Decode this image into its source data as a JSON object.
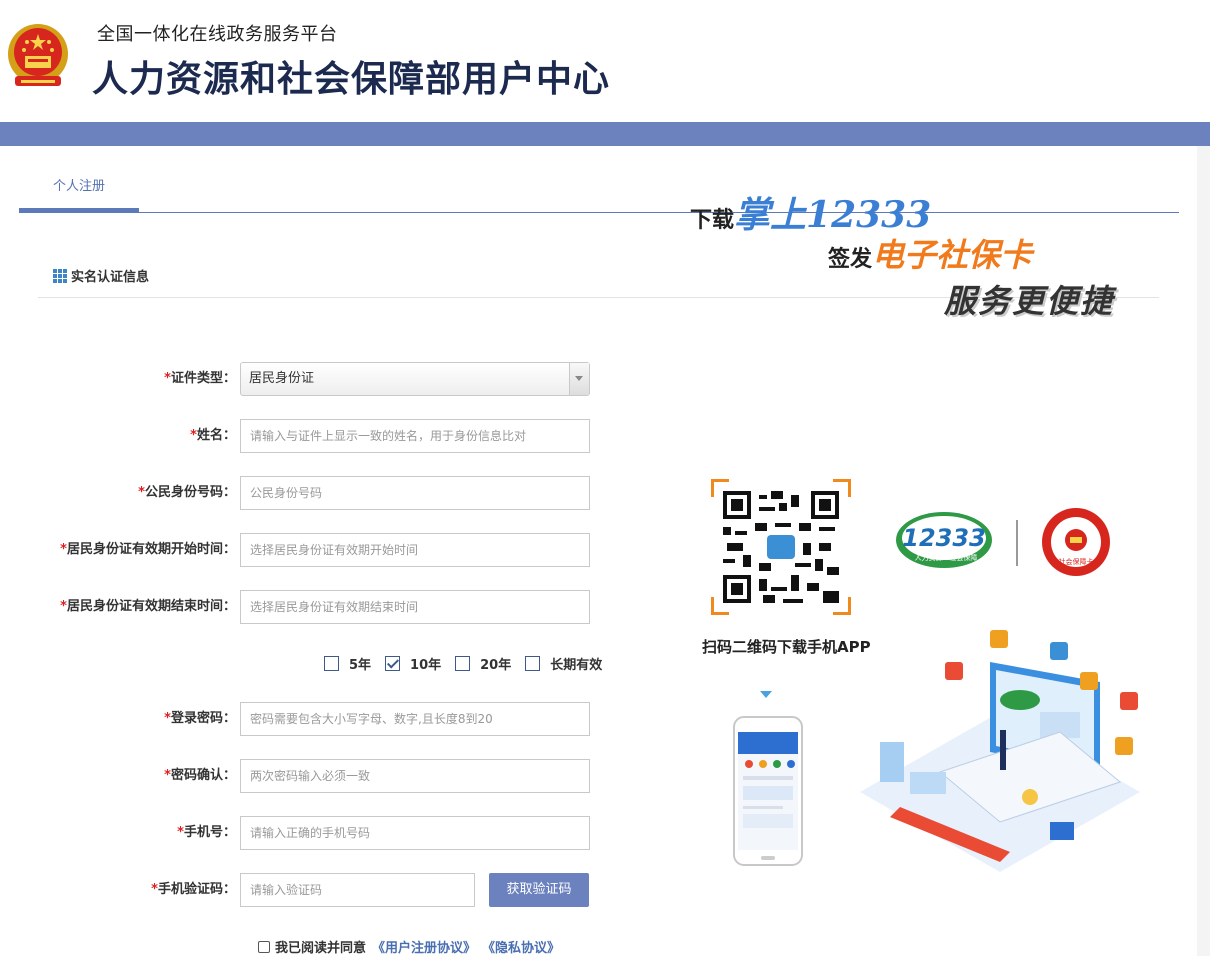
{
  "header": {
    "subtitle": "全国一体化在线政务服务平台",
    "title": "人力资源和社会保障部用户中心"
  },
  "tabs": [
    {
      "label": "个人注册",
      "active": true
    }
  ],
  "section": {
    "title": "实名认证信息"
  },
  "form": {
    "id_type": {
      "label": "证件类型",
      "value": "居民身份证"
    },
    "name": {
      "label": "姓名",
      "placeholder": "请输入与证件上显示一致的姓名，用于身份信息比对"
    },
    "id_number": {
      "label": "公民身份号码",
      "placeholder": "公民身份号码"
    },
    "valid_start": {
      "label": "居民身份证有效期开始时间",
      "placeholder": "选择居民身份证有效期开始时间"
    },
    "valid_end": {
      "label": "居民身份证有效期结束时间",
      "placeholder": "选择居民身份证有效期结束时间"
    },
    "validity_options": [
      {
        "label": "5年",
        "checked": false
      },
      {
        "label": "10年",
        "checked": true
      },
      {
        "label": "20年",
        "checked": false
      },
      {
        "label": "长期有效",
        "checked": false
      }
    ],
    "password": {
      "label": "登录密码",
      "placeholder": "密码需要包含大小写字母、数字,且长度8到20"
    },
    "password_confirm": {
      "label": "密码确认",
      "placeholder": "两次密码输入必须一致"
    },
    "phone": {
      "label": "手机号",
      "placeholder": "请输入正确的手机号码"
    },
    "sms_code": {
      "label": "手机验证码",
      "placeholder": "请输入验证码",
      "button": "获取验证码"
    },
    "label_suffix": "：",
    "required_mark": "*"
  },
  "agreement": {
    "text": "我已阅读并同意",
    "user_agreement": "《用户注册协议》",
    "privacy": "《隐私协议》"
  },
  "promo": {
    "line1_prefix": "下载",
    "line1_highlight": "掌上12333",
    "line2_prefix": "签发",
    "line2_highlight": "电子社保卡",
    "line3": "服务更便捷",
    "qr_caption": "扫码二维码下载手机APP",
    "logo_text": "12333",
    "logo_sub": "人力资源 · 社会保障",
    "card_text": "社会保障卡"
  },
  "colors": {
    "brand_band": "#6b82bf",
    "accent_blue": "#5c79ba",
    "required": "#e02020",
    "orange": "#f07a1c"
  }
}
